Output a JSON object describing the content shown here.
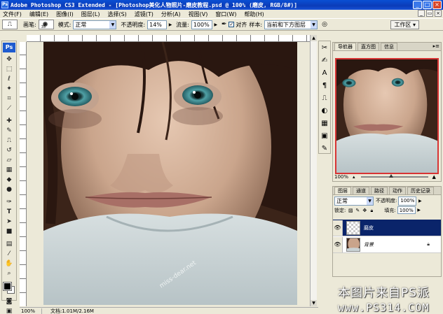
{
  "window": {
    "title": "Adobe Photoshop CS3 Extended - [Photoshop美化人物照片-磨皮教程.psd @ 100% (磨皮, RGB/8#)]",
    "app_icon": "Ps"
  },
  "menu": [
    "文件(F)",
    "编辑(E)",
    "图像(I)",
    "图层(L)",
    "选择(S)",
    "滤镜(T)",
    "分析(A)",
    "视图(V)",
    "窗口(W)",
    "帮助(H)"
  ],
  "options": {
    "brush_label": "画笔:",
    "brush_size": "35",
    "mode_label": "模式:",
    "mode_value": "正常",
    "opacity_label": "不透明度:",
    "opacity_value": "14%",
    "flow_label": "流量:",
    "flow_value": "100%",
    "align_label": "对齐",
    "sample_label": "样本:",
    "sample_value": "当前和下方图层",
    "workspace_label": "工作区 ▾"
  },
  "toolbox": {
    "logo": "Ps",
    "tools": [
      "move-tool-icon",
      "marquee-tool-icon",
      "lasso-tool-icon",
      "magic-wand-icon",
      "crop-tool-icon",
      "slice-tool-icon",
      "healing-brush-icon",
      "brush-tool-icon",
      "clone-stamp-icon",
      "history-brush-icon",
      "eraser-icon",
      "gradient-icon",
      "blur-tool-icon",
      "dodge-tool-icon",
      "pen-tool-icon",
      "type-tool-icon",
      "path-select-icon",
      "shape-tool-icon",
      "notes-icon",
      "eyedropper-icon",
      "hand-tool-icon",
      "zoom-tool-icon"
    ]
  },
  "document": {
    "zoom": "100%",
    "doc_info": "文档:1.01M/2.16M",
    "image_watermark": "miss-dear.net"
  },
  "navigator": {
    "tabs": [
      "导航器",
      "直方图",
      "信息"
    ],
    "active_tab": 0,
    "zoom": "100%",
    "frame_color": "#d83434"
  },
  "layers": {
    "tabs": [
      "图层",
      "通道",
      "路径",
      "动作",
      "历史记录"
    ],
    "active_tab": 0,
    "blend_mode": "正常",
    "opacity_label": "不透明度:",
    "opacity_value": "100%",
    "lock_label": "锁定:",
    "fill_label": "填充:",
    "fill_value": "100%",
    "items": [
      {
        "name": "磨皮",
        "selected": true,
        "locked": false
      },
      {
        "name": "背景",
        "selected": false,
        "locked": true
      }
    ],
    "selected_color": "#0a246a"
  },
  "watermark": {
    "line1": "本图片来自PS派",
    "line2": "www.PS314.COM"
  }
}
